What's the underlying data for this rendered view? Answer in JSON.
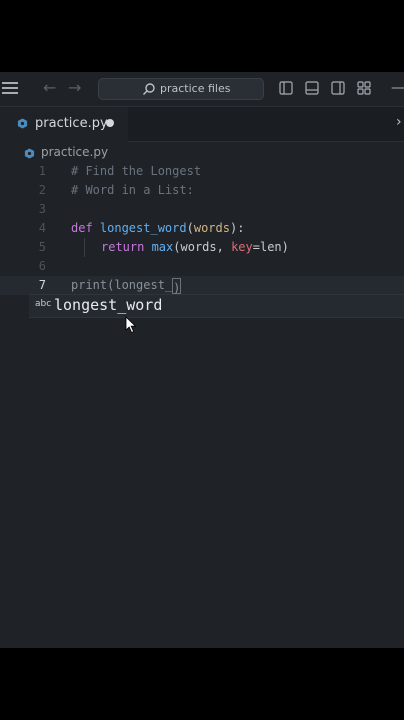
{
  "search": {
    "label": "practice files"
  },
  "tab": {
    "label": "practice.py"
  },
  "breadcrumb": {
    "label": "practice.py"
  },
  "editor": {
    "line_numbers": [
      "1",
      "2",
      "3",
      "4",
      "5",
      "6",
      "7"
    ],
    "current_line": 7,
    "lines": {
      "l1": "# Find the Longest",
      "l2": "# Word in a List:",
      "l4_kw": "def ",
      "l4_fn": "longest_word",
      "l4_open": "(",
      "l4_param": "words",
      "l4_close": "):",
      "l5_kw": "return ",
      "l5_fn": "max",
      "l5_a": "(words, ",
      "l5_key": "key",
      "l5_b": "=len)",
      "l7_fn": "print",
      "l7_open": "(",
      "l7_typed": "longest_",
      "l7_close": ")"
    }
  },
  "suggestion": {
    "kind": "abc",
    "label": "longest_word"
  },
  "colors": {
    "background": "#1f2328",
    "keyword": "#c678dd",
    "function": "#61afef",
    "comment": "#6a737d",
    "parameter": "#d4b483",
    "key": "#e06c75"
  }
}
